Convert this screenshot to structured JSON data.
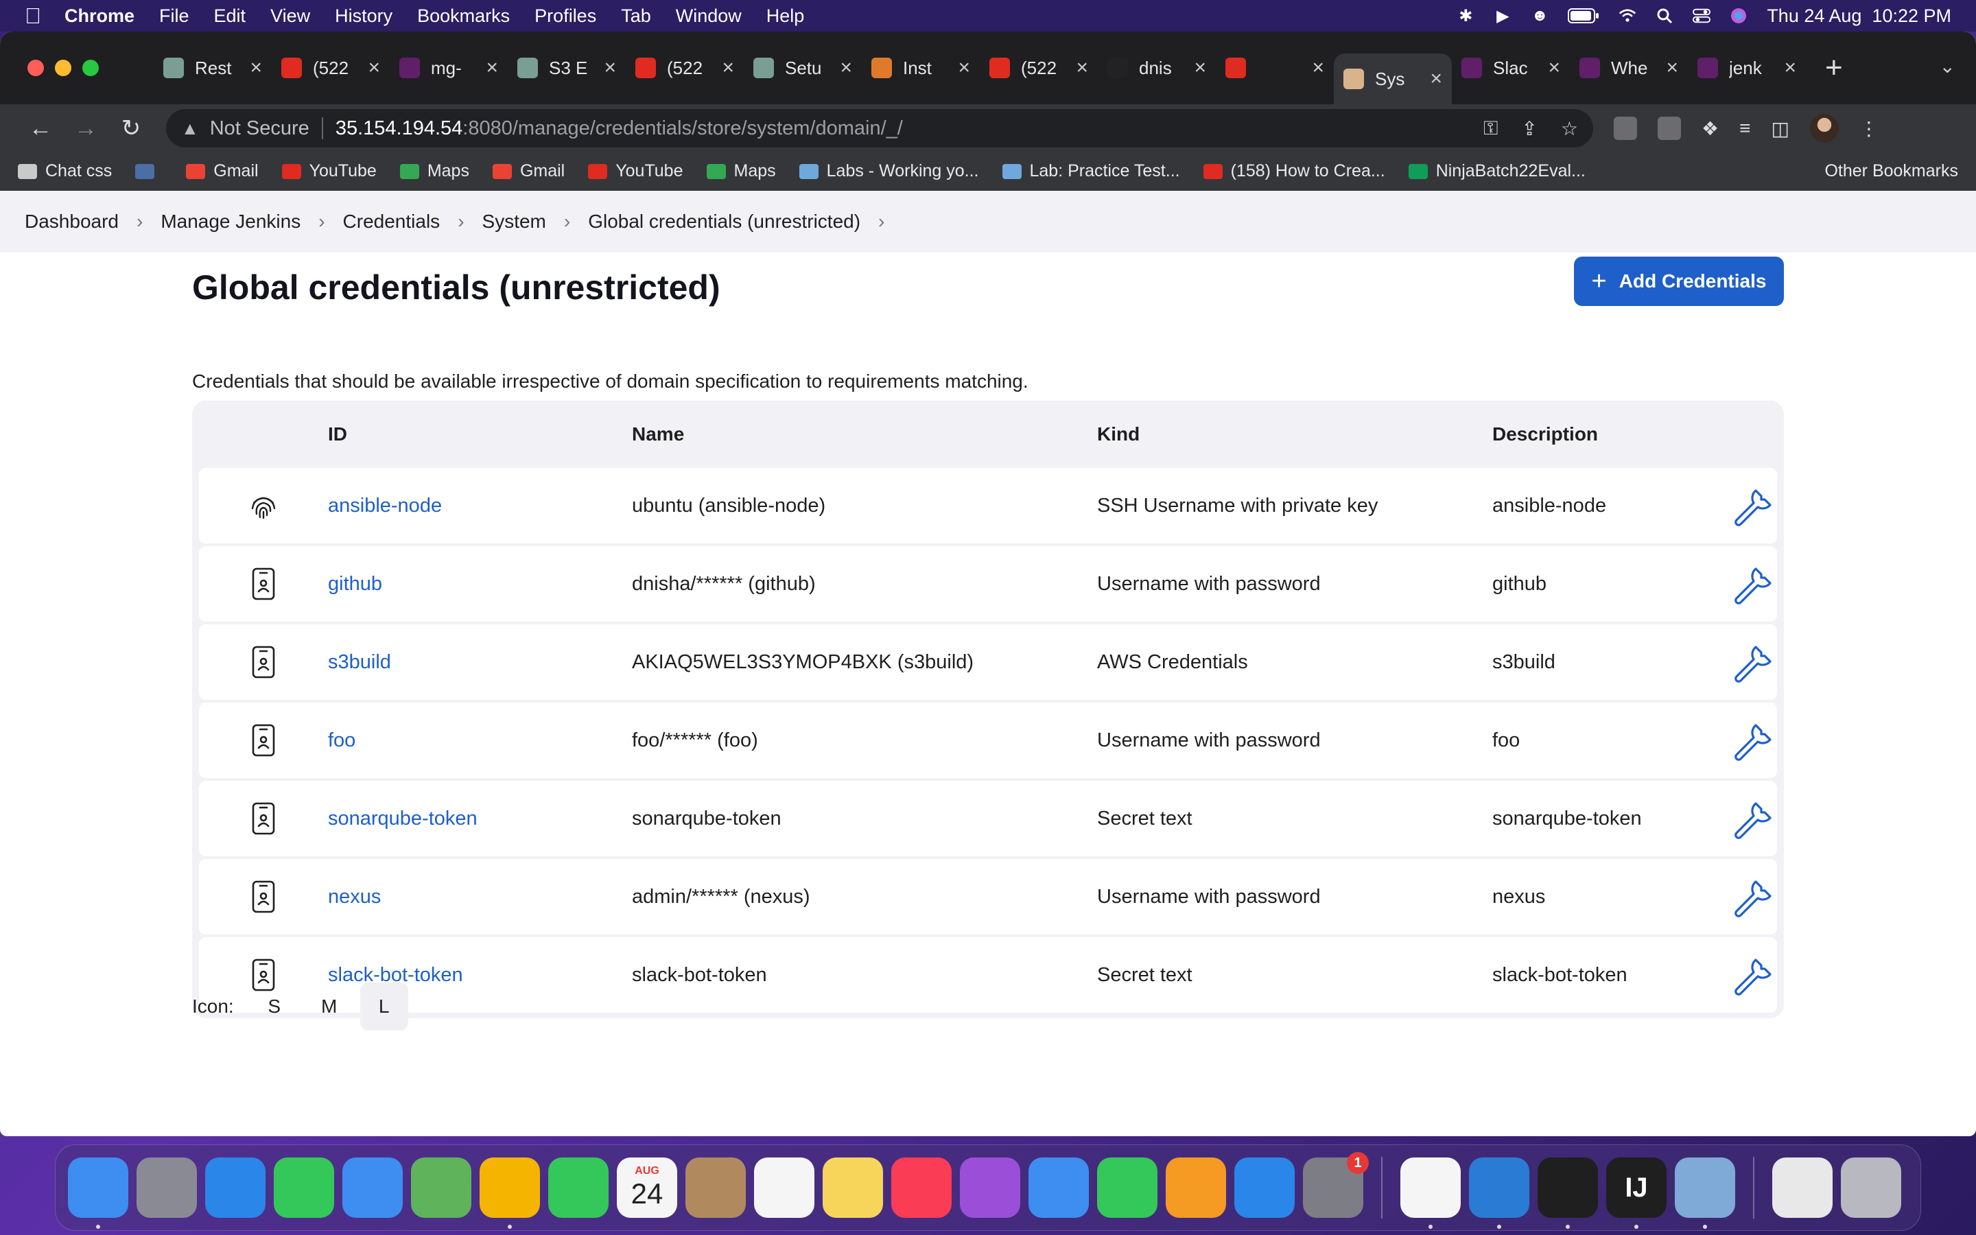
{
  "menubar": {
    "app": "Chrome",
    "items": [
      "File",
      "Edit",
      "View",
      "History",
      "Bookmarks",
      "Profiles",
      "Tab",
      "Window",
      "Help"
    ],
    "datetime": "Thu 24 Aug  10:22 PM"
  },
  "tabs": [
    {
      "label": "Rest",
      "icon": "chatgpt-icon",
      "color": "#7a9e93"
    },
    {
      "label": "(522",
      "icon": "youtube-icon",
      "color": "#e02b20"
    },
    {
      "label": "mg-",
      "icon": "slack-icon",
      "color": "#611f69"
    },
    {
      "label": "S3 E",
      "icon": "chatgpt-icon",
      "color": "#7a9e93"
    },
    {
      "label": "(522",
      "icon": "youtube-icon",
      "color": "#e02b20"
    },
    {
      "label": "Setu",
      "icon": "chatgpt-icon",
      "color": "#7a9e93"
    },
    {
      "label": "Inst",
      "icon": "site-icon",
      "color": "#e07a2b"
    },
    {
      "label": "(522",
      "icon": "youtube-icon",
      "color": "#e02b20"
    },
    {
      "label": "dnis",
      "icon": "github-icon",
      "color": "#222222"
    },
    {
      "label": "",
      "icon": "youtube-icon",
      "color": "#e02b20"
    },
    {
      "label": "Sys",
      "icon": "jenkins-icon",
      "color": "#d9b38c",
      "active": true
    },
    {
      "label": "Slac",
      "icon": "slack-icon",
      "color": "#611f69"
    },
    {
      "label": "Whe",
      "icon": "slack-icon",
      "color": "#611f69"
    },
    {
      "label": "jenk",
      "icon": "slack-icon",
      "color": "#611f69"
    }
  ],
  "address": {
    "warning": "Not Secure",
    "host": "35.154.194.54",
    "path": ":8080/manage/credentials/store/system/domain/_/"
  },
  "bookmarks": [
    {
      "label": "Chat css",
      "icon": "folder-icon",
      "color": "#c9c9c9"
    },
    {
      "label": "",
      "icon": "extension-icon",
      "color": "#4a6fa5"
    },
    {
      "label": "Gmail",
      "icon": "gmail-icon",
      "color": "#ea4335"
    },
    {
      "label": "YouTube",
      "icon": "youtube-icon",
      "color": "#e02b20"
    },
    {
      "label": "Maps",
      "icon": "maps-icon",
      "color": "#34a853"
    },
    {
      "label": "Gmail",
      "icon": "gmail-icon",
      "color": "#ea4335"
    },
    {
      "label": "YouTube",
      "icon": "youtube-icon",
      "color": "#e02b20"
    },
    {
      "label": "Maps",
      "icon": "maps-icon",
      "color": "#34a853"
    },
    {
      "label": "Labs - Working yo...",
      "icon": "eye-icon",
      "color": "#6fa8dc"
    },
    {
      "label": "Lab: Practice Test...",
      "icon": "eye-icon",
      "color": "#6fa8dc"
    },
    {
      "label": "(158) How to Crea...",
      "icon": "youtube-icon",
      "color": "#e02b20"
    },
    {
      "label": "NinjaBatch22Eval...",
      "icon": "sheets-icon",
      "color": "#0f9d58"
    }
  ],
  "other_bookmarks": "Other Bookmarks",
  "breadcrumbs": [
    "Dashboard",
    "Manage Jenkins",
    "Credentials",
    "System",
    "Global credentials (unrestricted)"
  ],
  "page": {
    "title": "Global credentials (unrestricted)",
    "add_button": "Add Credentials",
    "description": "Credentials that should be available irrespective of domain specification to requirements matching."
  },
  "table": {
    "headers": {
      "id": "ID",
      "name": "Name",
      "kind": "Kind",
      "description": "Description"
    },
    "rows": [
      {
        "icon": "fingerprint-icon",
        "id": "ansible-node",
        "name": "ubuntu (ansible-node)",
        "kind": "SSH Username with private key",
        "description": "ansible-node"
      },
      {
        "icon": "id-badge-icon",
        "id": "github",
        "name": "dnisha/****** (github)",
        "kind": "Username with password",
        "description": "github"
      },
      {
        "icon": "id-badge-icon",
        "id": "s3build",
        "name": "AKIAQ5WEL3S3YMOP4BXK (s3build)",
        "kind": "AWS Credentials",
        "description": "s3build"
      },
      {
        "icon": "id-badge-icon",
        "id": "foo",
        "name": "foo/****** (foo)",
        "kind": "Username with password",
        "description": "foo"
      },
      {
        "icon": "id-badge-icon",
        "id": "sonarqube-token",
        "name": "sonarqube-token",
        "kind": "Secret text",
        "description": "sonarqube-token"
      },
      {
        "icon": "id-badge-icon",
        "id": "nexus",
        "name": "admin/****** (nexus)",
        "kind": "Username with password",
        "description": "nexus"
      },
      {
        "icon": "id-badge-icon",
        "id": "slack-bot-token",
        "name": "slack-bot-token",
        "kind": "Secret text",
        "description": "slack-bot-token"
      }
    ]
  },
  "icon_size": {
    "label": "Icon:",
    "options": [
      "S",
      "M",
      "L"
    ],
    "selected": "L"
  },
  "dock": [
    {
      "name": "finder",
      "color": "#3d8ef0"
    },
    {
      "name": "launchpad",
      "color": "#8a8a95"
    },
    {
      "name": "safari",
      "color": "#2a86e8"
    },
    {
      "name": "messages",
      "color": "#34c759"
    },
    {
      "name": "mail",
      "color": "#3d8ef0"
    },
    {
      "name": "maps",
      "color": "#5fb35a"
    },
    {
      "name": "photos",
      "color": "#f4b400"
    },
    {
      "name": "facetime",
      "color": "#34c759"
    },
    {
      "name": "calendar",
      "color": "#f5f5f5",
      "text": "24",
      "subtext": "AUG"
    },
    {
      "name": "contacts",
      "color": "#b08a5e"
    },
    {
      "name": "reminders",
      "color": "#f5f5f5"
    },
    {
      "name": "notes",
      "color": "#f7d55a"
    },
    {
      "name": "music",
      "color": "#fa3c55"
    },
    {
      "name": "podcasts",
      "color": "#9b4fd8"
    },
    {
      "name": "keynote",
      "color": "#3d8ef0"
    },
    {
      "name": "numbers",
      "color": "#34c759"
    },
    {
      "name": "pages",
      "color": "#f59a23"
    },
    {
      "name": "app-store",
      "color": "#2a86e8"
    },
    {
      "name": "system-settings",
      "color": "#7d7d85",
      "badge": "1"
    },
    {
      "name": "chrome",
      "color": "#f5f5f5"
    },
    {
      "name": "vscode",
      "color": "#2a7bd4"
    },
    {
      "name": "terminal",
      "color": "#1f1f1f"
    },
    {
      "name": "intellij",
      "color": "#1f1f1f",
      "text": "IJ"
    },
    {
      "name": "preview",
      "color": "#7fa9d6"
    },
    {
      "name": "documents",
      "color": "#e8e8e8"
    },
    {
      "name": "trash",
      "color": "#b8b8c0"
    }
  ]
}
